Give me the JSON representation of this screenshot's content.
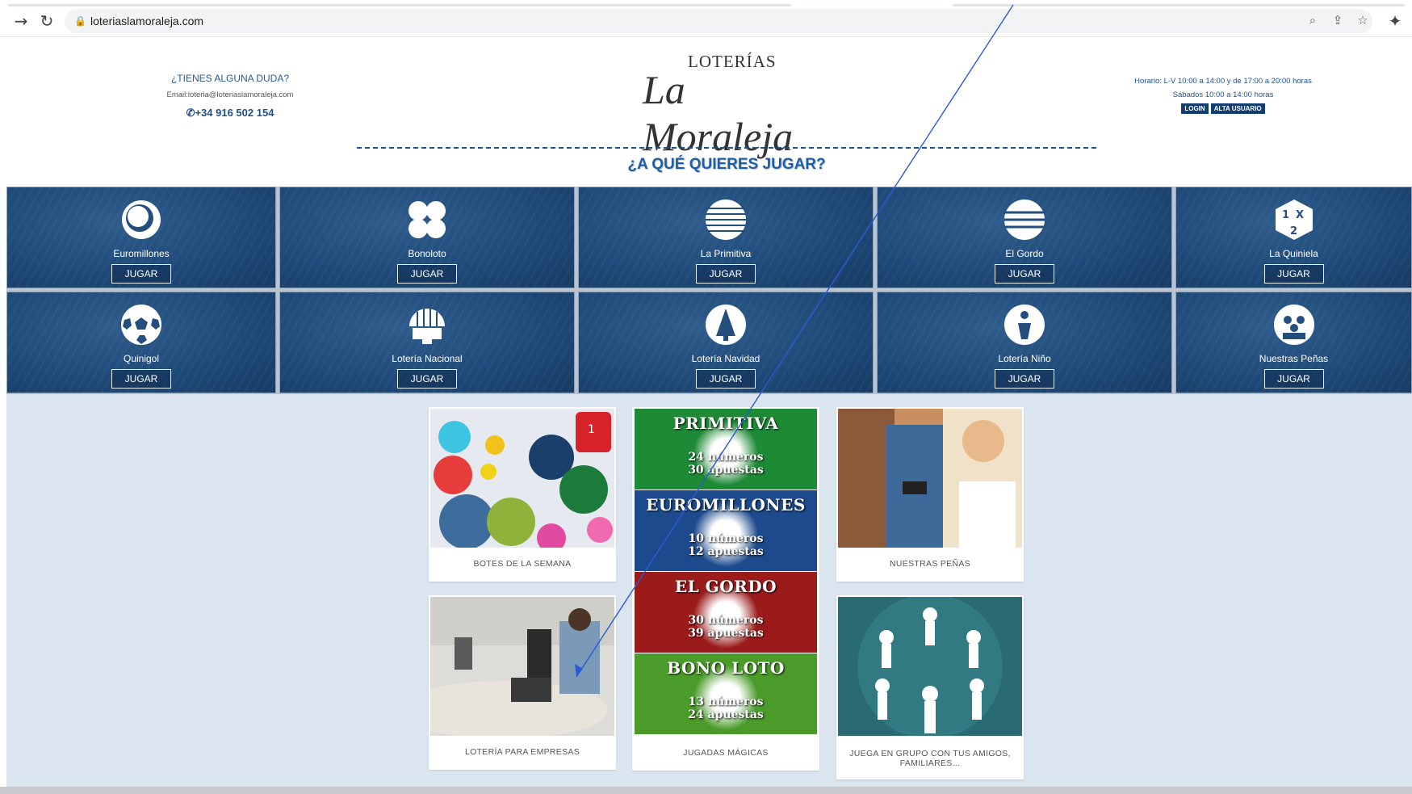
{
  "browser": {
    "url": "loteriaslamoraleja.com",
    "icons": [
      "forward-arrow-icon",
      "reload-icon",
      "lock-icon",
      "zoom-icon",
      "share-icon",
      "bookmark-star-icon",
      "extensions-puzzle-icon"
    ]
  },
  "header": {
    "question": "¿TIENES ALGUNA DUDA?",
    "email": "Email:loteria@loteriaslamoraleja.com",
    "phone": "+34 916 502 154",
    "logo_top": "LOTERÍAS",
    "logo_main": "La Moraleja",
    "hours_line1": "Horario: L-V 10:00 a 14:00 y de 17:00 a 20:00 horas",
    "hours_line2": "Sábados 10:00 a 14:00 horas",
    "login_label": "LOGIN",
    "signup_label": "ALTA USUARIO"
  },
  "section_title": "¿A QUÉ QUIERES JUGAR?",
  "games": [
    {
      "name": "Euromillones",
      "play": "JUGAR",
      "icon": "euromillones-icon"
    },
    {
      "name": "Bonoloto",
      "play": "JUGAR",
      "icon": "bonoloto-icon"
    },
    {
      "name": "La Primitiva",
      "play": "JUGAR",
      "icon": "primitiva-icon"
    },
    {
      "name": "El Gordo",
      "play": "JUGAR",
      "icon": "el-gordo-icon"
    },
    {
      "name": "La Quiniela",
      "play": "JUGAR",
      "icon": "quiniela-icon"
    },
    {
      "name": "Quinigol",
      "play": "JUGAR",
      "icon": "quinigol-icon"
    },
    {
      "name": "Lotería Nacional",
      "play": "JUGAR",
      "icon": "loteria-nacional-icon"
    },
    {
      "name": "Lotería Navidad",
      "play": "JUGAR",
      "icon": "loteria-navidad-icon"
    },
    {
      "name": "Lotería Niño",
      "play": "JUGAR",
      "icon": "loteria-nino-icon"
    },
    {
      "name": "Nuestras Peñas",
      "play": "JUGAR",
      "icon": "penas-icon"
    }
  ],
  "cards": {
    "botes": "BOTES DE LA SEMANA",
    "penas": "NUESTRAS PEÑAS",
    "empresas": "LOTERÍA PARA EMPRESAS",
    "magicas": "JUGADAS MÁGICAS",
    "grupo": "JUEGA EN GRUPO CON TUS AMIGOS, FAMILIARES..."
  },
  "magic_banners": [
    {
      "title": "PRIMITIVA",
      "line1": "24 números",
      "line2": "30 apuestas"
    },
    {
      "title": "EUROMILLONES",
      "line1": "10 números",
      "line2": "12 apuestas"
    },
    {
      "title": "EL GORDO",
      "line1": "30 números",
      "line2": "39 apuestas"
    },
    {
      "title": "BONO LOTO",
      "line1": "13 números",
      "line2": "24 apuestas"
    }
  ],
  "colors": {
    "brand_blue": "#1d4f8c",
    "tile_blue": "#1f4a79",
    "content_bg": "#dbe5f0",
    "primitiva": "#1d8a35",
    "euromillones": "#1d4a8c",
    "el_gordo": "#9b1a1a",
    "bonoloto": "#4a9b2a"
  }
}
